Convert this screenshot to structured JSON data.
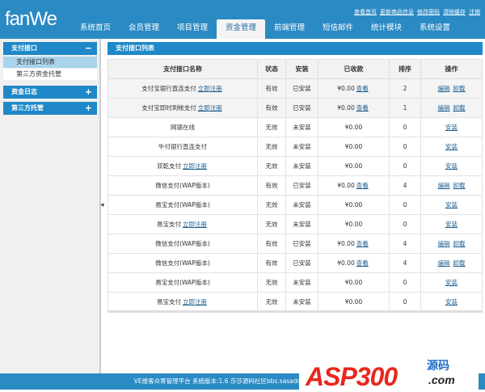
{
  "header": {
    "logo": "fanWe",
    "links": [
      "查看首页",
      "更新商品信息",
      "修改密码",
      "清除缓存",
      "注销"
    ],
    "nav": [
      "系统首页",
      "会员管理",
      "项目管理",
      "资金管理",
      "前端管理",
      "短信邮件",
      "统计模块",
      "系统设置"
    ],
    "active_nav": 3
  },
  "sidebar": {
    "groups": [
      {
        "label": "支付接口",
        "toggle": "−",
        "items": [
          "支付接口列表",
          "第三方资金托管"
        ]
      },
      {
        "label": "资金日志",
        "toggle": "+"
      },
      {
        "label": "第三方托管",
        "toggle": "+"
      }
    ]
  },
  "panel": {
    "title": "支付接口列表"
  },
  "table": {
    "headers": [
      "支付接口名称",
      "状态",
      "安装",
      "已收款",
      "排序",
      "操作"
    ],
    "rows": [
      {
        "name": "支付宝银行直连支付",
        "reg": "立即注册",
        "status": "有效",
        "install": "已安装",
        "amount": "¥0.00",
        "view": "查看",
        "sort": "2",
        "ops": [
          "编辑",
          "卸载"
        ]
      },
      {
        "name": "支付宝即时到帐支付",
        "reg": "立即注册",
        "status": "有效",
        "install": "已安装",
        "amount": "¥0.00",
        "view": "查看",
        "sort": "1",
        "ops": [
          "编辑",
          "卸载"
        ]
      },
      {
        "name": "网银在线",
        "status": "无效",
        "install": "未安装",
        "amount": "¥0.00",
        "sort": "0",
        "ops": [
          "安装"
        ]
      },
      {
        "name": "牛付银行直连支付",
        "status": "无效",
        "install": "未安装",
        "amount": "¥0.00",
        "sort": "0",
        "ops": [
          "安装"
        ]
      },
      {
        "name": "双乾支付",
        "reg": "立即注册",
        "status": "无效",
        "install": "未安装",
        "amount": "¥0.00",
        "sort": "0",
        "ops": [
          "安装"
        ]
      },
      {
        "name": "微信支付(WAP版本)",
        "status": "有效",
        "install": "已安装",
        "amount": "¥0.00",
        "view": "查看",
        "sort": "4",
        "ops": [
          "编辑",
          "卸载"
        ]
      },
      {
        "name": "易宝支付(WAP版本)",
        "status": "无效",
        "install": "未安装",
        "amount": "¥0.00",
        "sort": "0",
        "ops": [
          "安装"
        ]
      },
      {
        "name": "易宝支付",
        "reg": "立即注册",
        "status": "无效",
        "install": "未安装",
        "amount": "¥0.00",
        "sort": "0",
        "ops": [
          "安装"
        ]
      },
      {
        "name": "微信支付(WAP版本)",
        "status": "有效",
        "install": "已安装",
        "amount": "¥0.00",
        "view": "查看",
        "sort": "4",
        "ops": [
          "编辑",
          "卸载"
        ]
      },
      {
        "name": "微信支付(WAP版本)",
        "status": "有效",
        "install": "已安装",
        "amount": "¥0.00",
        "view": "查看",
        "sort": "4",
        "ops": [
          "编辑",
          "卸载"
        ]
      },
      {
        "name": "易宝支付(WAP版本)",
        "status": "无效",
        "install": "未安装",
        "amount": "¥0.00",
        "sort": "0",
        "ops": [
          "安装"
        ]
      },
      {
        "name": "易宝支付",
        "reg": "立即注册",
        "status": "无效",
        "install": "未安装",
        "amount": "¥0.00",
        "sort": "0",
        "ops": [
          "安装"
        ]
      }
    ]
  },
  "footer": {
    "text": "VE维客众筹管理平台 系统版本:1.6 莎莎源码社区bbs.sasadown.cn"
  },
  "watermark": {
    "text": "ASP300",
    "sub": "源码",
    "domain": ".com"
  },
  "colors": {
    "primary": "#2a8ac4",
    "link": "#1f5f8f"
  }
}
